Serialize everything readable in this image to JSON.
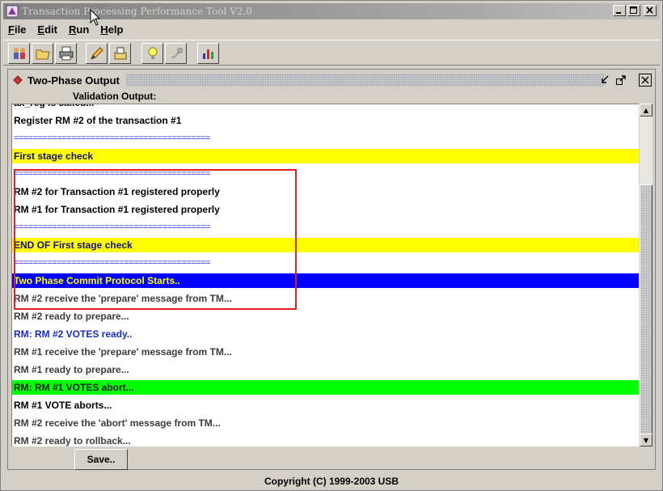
{
  "window": {
    "title": "Transaction Processing Performance Tool V2.0",
    "controls": {
      "minimize": "_",
      "maximize": "□",
      "close": "×"
    }
  },
  "menu": {
    "items": [
      {
        "label": "File",
        "mnemonic": "F",
        "rest": "ile"
      },
      {
        "label": "Edit",
        "mnemonic": "E",
        "rest": "dit"
      },
      {
        "label": "Run",
        "mnemonic": "R",
        "rest": "un"
      },
      {
        "label": "Help",
        "mnemonic": "H",
        "rest": "elp"
      }
    ]
  },
  "toolbar": {
    "buttons": [
      {
        "icon": "people-icon"
      },
      {
        "icon": "open-folder-icon"
      },
      {
        "icon": "printer-icon"
      },
      {
        "icon": "edit-pencil-icon"
      },
      {
        "icon": "import-icon"
      },
      {
        "icon": "lightbulb-icon"
      },
      {
        "icon": "plug-icon"
      },
      {
        "icon": "chart-icon"
      }
    ]
  },
  "frame": {
    "title": "Two-Phase Output",
    "label": "Validation Output:",
    "close": "×"
  },
  "output": {
    "lines": [
      {
        "text": "ax_reg is called...",
        "style": "black"
      },
      {
        "text": "Register RM #2 of the transaction #1",
        "style": "black"
      },
      {
        "text": "=========================================",
        "style": "sep"
      },
      {
        "text": " First stage check",
        "style": "yellow"
      },
      {
        "text": "=========================================",
        "style": "sep"
      },
      {
        "text": "RM #2 for Transaction #1 registered properly",
        "style": "black"
      },
      {
        "text": "RM #1 for Transaction #1 registered properly",
        "style": "black"
      },
      {
        "text": "=========================================",
        "style": "sep"
      },
      {
        "text": " END OF First stage check",
        "style": "yellow"
      },
      {
        "text": "=========================================",
        "style": "sep"
      },
      {
        "text": "Two Phase Commit Protocol Starts..",
        "style": "bluebg"
      },
      {
        "text": "RM #2 receive the 'prepare' message from TM...",
        "style": "gray"
      },
      {
        "text": "RM #2 ready to prepare...",
        "style": "gray"
      },
      {
        "text": "RM: RM #2 VOTES ready..",
        "style": "blue"
      },
      {
        "text": "RM #1 receive the 'prepare' message from TM...",
        "style": "gray"
      },
      {
        "text": "RM #1 ready to prepare...",
        "style": "gray"
      },
      {
        "text": "RM: RM #1 VOTES abort...",
        "style": "greenbg"
      },
      {
        "text": "RM #1 VOTE aborts...",
        "style": "black"
      },
      {
        "text": "RM #2 receive the 'abort' message from TM...",
        "style": "gray"
      },
      {
        "text": "RM #2 ready to rollback...",
        "style": "gray"
      }
    ]
  },
  "scrollbar": {
    "up": "▲",
    "down": "▼"
  },
  "save_button": "Save..",
  "status": "Copyright (C) 1999-2003 USB",
  "colors": {
    "highlight_yellow": "#ffff00",
    "highlight_blue": "#0000ff",
    "highlight_green": "#00ff00",
    "annotation_red": "#e02020"
  }
}
